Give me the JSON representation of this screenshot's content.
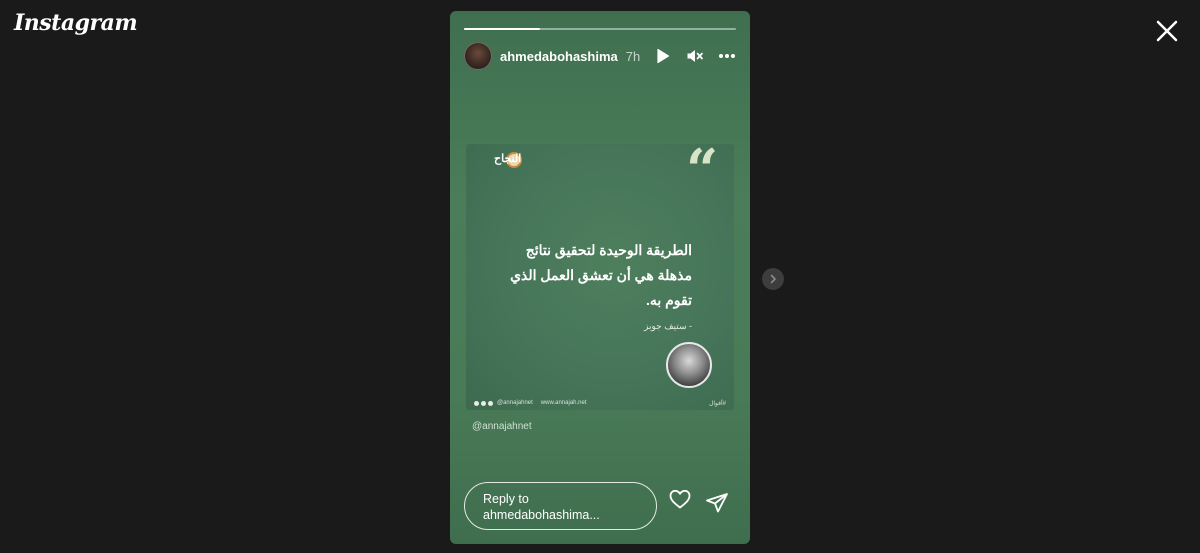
{
  "app": {
    "logo": "Instagram"
  },
  "story": {
    "progress": 0.28,
    "username": "ahmedabohashima",
    "time": "7h",
    "controls": [
      "play-icon",
      "mute-icon",
      "more-icon"
    ],
    "card": {
      "brand": "النجاح",
      "quote_mark": "“",
      "quote": "الطريقة الوحيدة لتحقيق نتائج مذهلة هي أن تعشق العمل الذي تقوم به.",
      "author": "- ستيف جوبز",
      "footer_handle": "@annajahnet",
      "footer_site": "www.annajah.net",
      "footer_tag": "#أقوال"
    },
    "mention": "@annajahnet",
    "reply_placeholder": "Reply to ahmedabohashima..."
  },
  "colors": {
    "background": "#1a1a1a",
    "story_bg": "#4b7d5a",
    "text": "#ffffff"
  }
}
